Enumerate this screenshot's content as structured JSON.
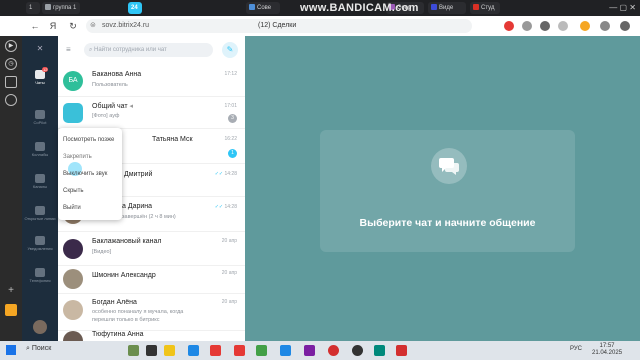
{
  "browser": {
    "tabs": [
      {
        "label": "1",
        "color": "#5a5a5a"
      },
      {
        "label": "группа 1",
        "color": "#9aa0a6"
      },
      {
        "label": "24",
        "color": "#2fc6f6"
      },
      {
        "label": "Сове",
        "color": "#4e8fd8"
      },
      {
        "label": "Совр",
        "color": "#9b59b6"
      },
      {
        "label": "Виде",
        "color": "#3c4bd9"
      },
      {
        "label": "Студ",
        "color": "#d93025"
      }
    ],
    "overlay_text": "www.BANDICAM.com",
    "url": "sovz.bitrix24.ru",
    "page_title": "(12) Сделки"
  },
  "b24_sidebar": {
    "items": [
      {
        "label": "Чаты",
        "badge": "12"
      },
      {
        "label": "CoPilot"
      },
      {
        "label": "Коллабы"
      },
      {
        "label": "Каналы"
      },
      {
        "label": "Открытые линии"
      },
      {
        "label": "Уведомления"
      },
      {
        "label": "Телефония"
      }
    ]
  },
  "chat_list": {
    "search_placeholder": "Найти сотрудника или чат",
    "items": [
      {
        "name": "Баканова Анна",
        "preview": "Пользователь",
        "time": "17:12",
        "avatar_text": "БА",
        "avatar_color": "#2fbf9a"
      },
      {
        "name": "Общий чат",
        "preview": "[Фото] ауф",
        "time": "17:01",
        "badge": "3",
        "avatar_color": "#3ac0d9"
      },
      {
        "name": "Татьяна Мск",
        "preview": "",
        "time": "16:22",
        "badge": "1",
        "avatar_color": "#b98a6a"
      },
      {
        "name": "Дмитрий",
        "preview": "",
        "time": "14:28",
        "avatar_color": "#4f6478"
      },
      {
        "name": "а Дарина",
        "preview": "завершён (2 ч 8 мин)",
        "time": "14:28",
        "avatar_color": "#8e7a66"
      },
      {
        "name": "Баклажановый канал",
        "preview": "[Видео]",
        "time": "20 апр",
        "avatar_color": "#3b2a4a"
      },
      {
        "name": "Шмонин Александр",
        "preview": "",
        "time": "20 апр",
        "avatar_color": "#9c8f7c"
      },
      {
        "name": "Богдан Алёна",
        "preview": "особенно понаналу я мучала, когда перешли только в битрикс",
        "time": "20 апр",
        "avatar_color": "#c9b8a3"
      },
      {
        "name": "Тюфутина Анна",
        "preview": "",
        "time": "",
        "avatar_color": "#6b5b52"
      }
    ]
  },
  "context_menu": {
    "items": [
      "Посмотреть позже",
      "Закрепить",
      "Выключить звук",
      "Скрыть",
      "Выйти"
    ]
  },
  "main": {
    "empty_text": "Выберите чат и начните общение"
  },
  "taskbar": {
    "search_label": "Поиск",
    "lang": "РУС",
    "time": "17:57",
    "date": "21.04.2025"
  }
}
